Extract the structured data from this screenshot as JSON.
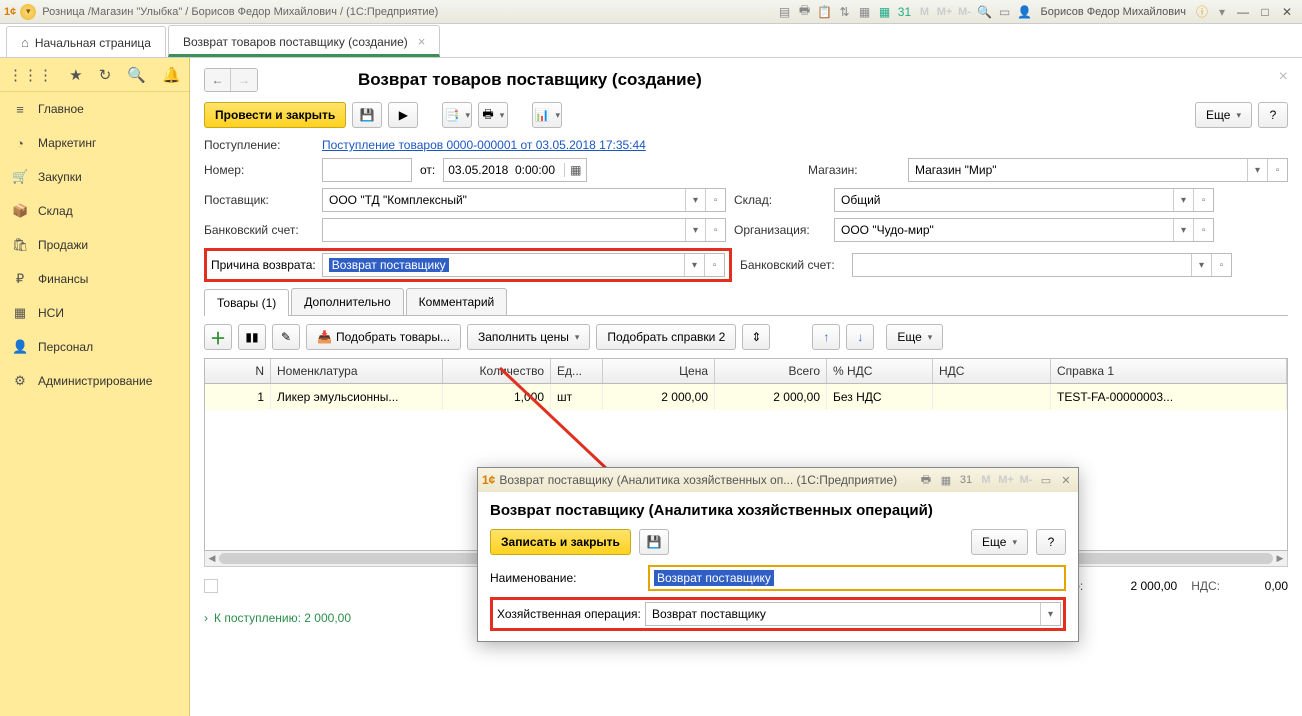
{
  "titlebar": {
    "title": "Розница /Магазин \"Улыбка\" / Борисов Федор Михайлович / (1С:Предприятие)",
    "user": "Борисов Федор Михайлович",
    "m1": "M",
    "m2": "M+",
    "m3": "M-"
  },
  "tabs": {
    "home": "Начальная страница",
    "doc": "Возврат товаров поставщику (создание)"
  },
  "sidebar": {
    "items": [
      {
        "icon": "≡",
        "label": "Главное"
      },
      {
        "icon": "◔",
        "label": "Маркетинг"
      },
      {
        "icon": "🛒",
        "label": "Закупки"
      },
      {
        "icon": "📦",
        "label": "Склад"
      },
      {
        "icon": "🛍",
        "label": "Продажи"
      },
      {
        "icon": "₽",
        "label": "Финансы"
      },
      {
        "icon": "▦",
        "label": "НСИ"
      },
      {
        "icon": "👤",
        "label": "Персонал"
      },
      {
        "icon": "⚙",
        "label": "Администрирование"
      }
    ]
  },
  "page": {
    "title": "Возврат товаров поставщику (создание)",
    "post_and_close": "Провести и закрыть",
    "more": "Еще",
    "help": "?",
    "receipt_label": "Поступление:",
    "receipt_link": "Поступление товаров 0000-000001 от 03.05.2018 17:35:44",
    "number_label": "Номер:",
    "from_label": "от:",
    "date": "03.05.2018  0:00:00",
    "store_label": "Магазин:",
    "store_val": "Магазин \"Мир\"",
    "supplier_label": "Поставщик:",
    "supplier_val": "ООО \"ТД \"Комплексный\"",
    "wh_label": "Склад:",
    "wh_val": "Общий",
    "bank_label": "Банковский счет:",
    "org_label": "Организация:",
    "org_val": "ООО \"Чудо-мир\"",
    "reason_label": "Причина возврата:",
    "reason_val": "Возврат поставщику",
    "bank2_label": "Банковский счет:",
    "tabs": {
      "goods": "Товары (1)",
      "extra": "Дополнительно",
      "comment": "Комментарий"
    },
    "tb": {
      "pick": "Подобрать товары...",
      "fill": "Заполнить цены",
      "ref": "Подобрать справки 2",
      "more": "Еще"
    },
    "cols": {
      "n": "N",
      "nom": "Номенклатура",
      "qty": "Количество",
      "ed": "Ед...",
      "price": "Цена",
      "total": "Всего",
      "vat": "% НДС",
      "nds": "НДС",
      "ref": "Справка 1"
    },
    "row": {
      "n": "1",
      "nom": "Ликер эмульсионны...",
      "qty": "1,000",
      "ed": "шт",
      "price": "2 000,00",
      "total": "2 000,00",
      "vat": "Без НДС",
      "nds": "",
      "ref": "TEST-FA-00000003..."
    },
    "footer": {
      "total_label": "Всего:",
      "total": "2 000,00",
      "nds_label": "НДС:",
      "nds": "0,00"
    },
    "bottom": "К поступлению: 2 000,00"
  },
  "popup": {
    "title": "Возврат поставщику (Аналитика хозяйственных оп...   (1С:Предприятие)",
    "h": "Возврат поставщику (Аналитика хозяйственных операций)",
    "save": "Записать и закрыть",
    "more": "Еще",
    "help": "?",
    "name_label": "Наименование:",
    "name_val": "Возврат поставщику",
    "op_label": "Хозяйственная операция:",
    "op_val": "Возврат поставщику",
    "m1": "M",
    "m2": "M+",
    "m3": "M-"
  }
}
